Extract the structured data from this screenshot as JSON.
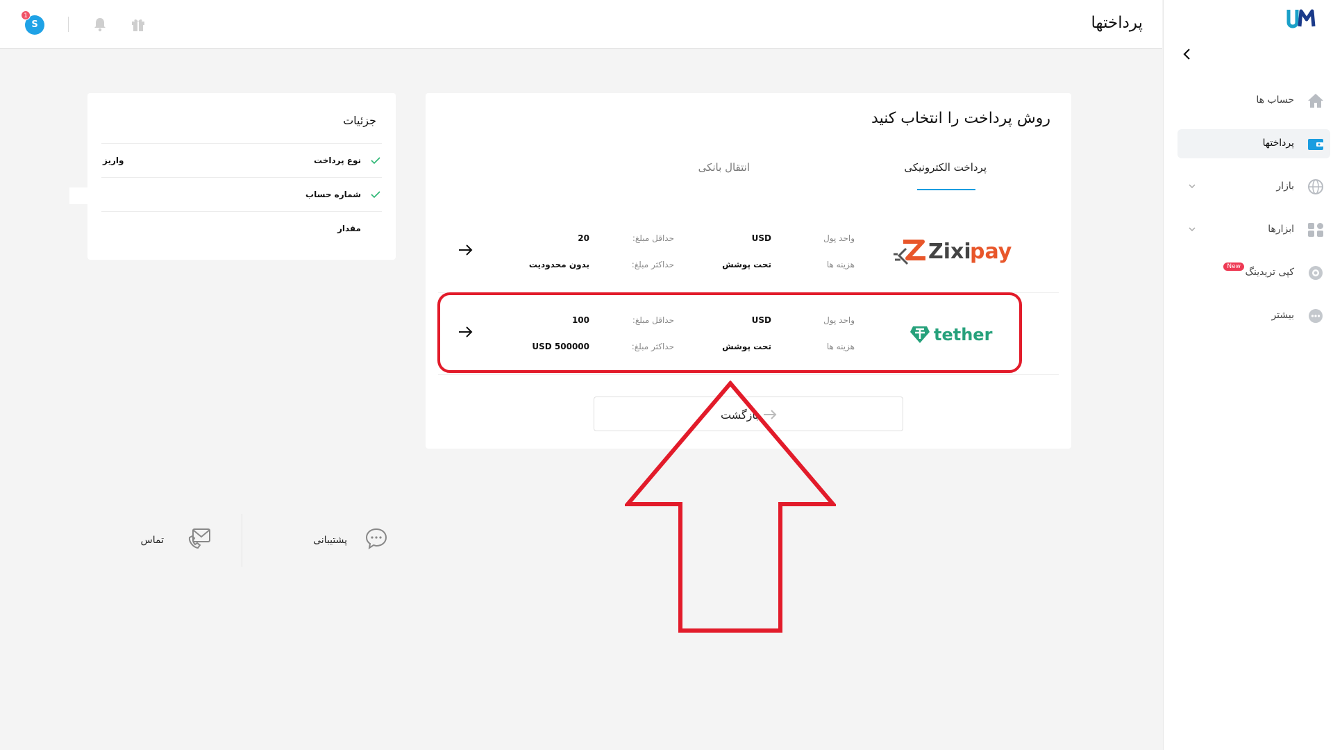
{
  "app": {
    "logo_text": "UM"
  },
  "header": {
    "title": "پرداختها",
    "avatar_letter": "S",
    "notification_count": "1"
  },
  "sidebar": {
    "items": [
      {
        "label": "حساب ها",
        "icon": "home-icon"
      },
      {
        "label": "پرداختها",
        "icon": "wallet-icon"
      },
      {
        "label": "بازار",
        "icon": "globe-icon"
      },
      {
        "label": "ابزارها",
        "icon": "grid-icon"
      },
      {
        "label": "کپی تریدینگ",
        "icon": "copy-trading-icon",
        "badge": "New"
      },
      {
        "label": "بیشتر",
        "icon": "more-icon"
      }
    ]
  },
  "main": {
    "title": "روش پرداخت را انتخاب کنید",
    "tabs": [
      {
        "label": "پرداخت الکترونیکی",
        "active": true
      },
      {
        "label": "انتقال بانکی",
        "active": false
      }
    ],
    "labels": {
      "currency": "واحد پول",
      "fees": "هزینه ها",
      "min_amount": "حداقل مبلغ:",
      "max_amount": "حداکثر مبلغ:"
    },
    "methods": [
      {
        "name": "zixipay",
        "currency": "USD",
        "fees": "تحت پوشش",
        "min": "20",
        "max": "بدون محدودیت"
      },
      {
        "name": "tether",
        "currency": "USD",
        "fees": "تحت پوشش",
        "min": "100",
        "max": "USD 500000"
      }
    ],
    "back_button": "بازگشت"
  },
  "details": {
    "title": "جزئیات",
    "rows": [
      {
        "label": "نوع پرداخت",
        "value": "واریز",
        "checked": true
      },
      {
        "label": "شماره حساب",
        "value": "",
        "checked": true
      },
      {
        "label": "مقدار",
        "value": "",
        "checked": false
      }
    ]
  },
  "footer": {
    "support": "پشتیبانی",
    "contact": "تماس"
  },
  "colors": {
    "accent": "#1a9de0",
    "annotation": "#e21b2a",
    "zixipay_orange": "#e8562a",
    "tether_green": "#26a17b"
  }
}
